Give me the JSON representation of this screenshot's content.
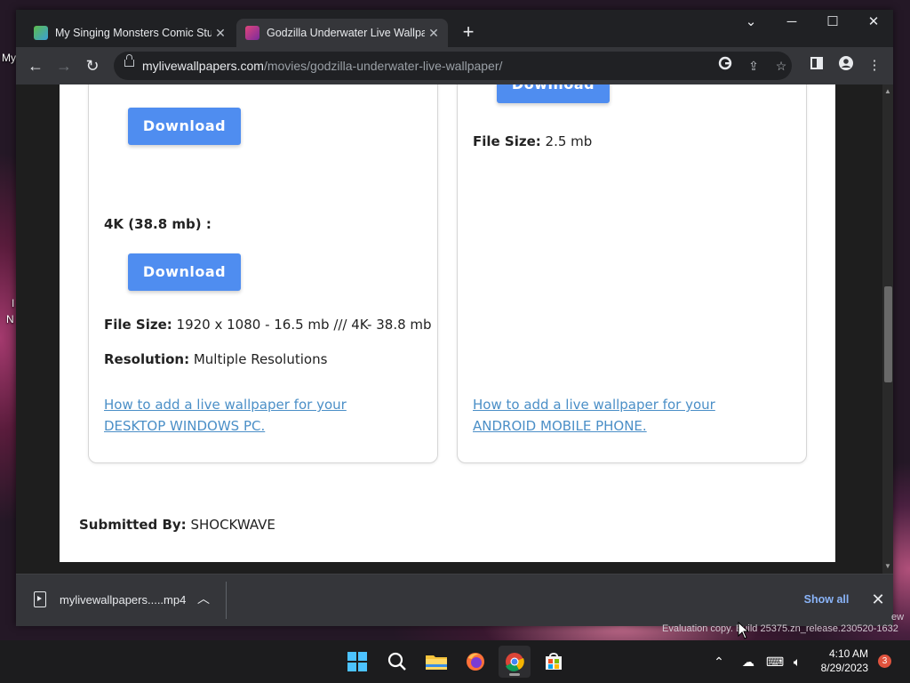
{
  "desktop": {
    "label_top": "My",
    "label_side1": "I",
    "label_side2": "N"
  },
  "tabs": [
    {
      "title": "My Singing Monsters Comic Stud",
      "active": false
    },
    {
      "title": "Godzilla Underwater Live Wallpap",
      "active": true
    }
  ],
  "window_controls": {
    "dropdown": "⌄",
    "minimize": "─",
    "maximize": "☐",
    "close": "✕"
  },
  "address": {
    "host": "mylivewallpapers.com",
    "path": "/movies/godzilla-underwater-live-wallpaper/"
  },
  "page": {
    "left_card": {
      "download_label_1": "Download",
      "heading_4k": "4K (38.8 mb) :",
      "download_label_2": "Download",
      "file_size_label": "File Size:",
      "file_size_value": " 1920 x 1080 - 16.5 mb /// 4K- 38.8 mb",
      "resolution_label": "Resolution:",
      "resolution_value": " Multiple Resolutions",
      "howto_line1": "How to add a live wallpaper for your",
      "howto_line2": "DESKTOP WINDOWS PC."
    },
    "right_card": {
      "download_label": "Download",
      "file_size_label": "File Size:",
      "file_size_value": " 2.5 mb",
      "howto_line1": "How to add a live wallpaper for your",
      "howto_line2": "ANDROID MOBILE PHONE."
    },
    "submitted_label": "Submitted By:",
    "submitted_value": " SHOCKWAVE"
  },
  "download_bar": {
    "filename": "mylivewallpapers.....mp4",
    "show_all": "Show all"
  },
  "watermark": "Evaluation copy. Build 25375.zn_release.230520-1632",
  "watermark_edge": "ew",
  "taskbar": {
    "time": "4:10 AM",
    "date": "8/29/2023",
    "notification_count": "3"
  }
}
